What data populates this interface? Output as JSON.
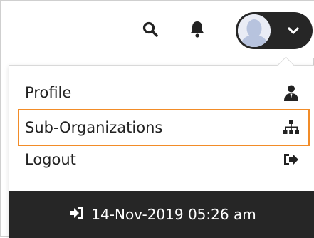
{
  "header": {
    "icons": {
      "search": "search-icon",
      "notifications": "bell-icon",
      "user_avatar": "avatar",
      "toggle": "chevron-down-icon"
    }
  },
  "user_menu": {
    "items": [
      {
        "label": "Profile",
        "icon": "user-icon"
      },
      {
        "label": "Sub-Organizations",
        "icon": "sitemap-icon"
      },
      {
        "label": "Logout",
        "icon": "sign-out-icon"
      }
    ],
    "highlighted_item": "Sub-Organizations",
    "last_login": "14-Nov-2019 05:26 am",
    "last_login_icon": "sign-in-icon"
  },
  "colors": {
    "dark": "#262626",
    "highlight_border": "#f28c28",
    "text": "#222222"
  }
}
